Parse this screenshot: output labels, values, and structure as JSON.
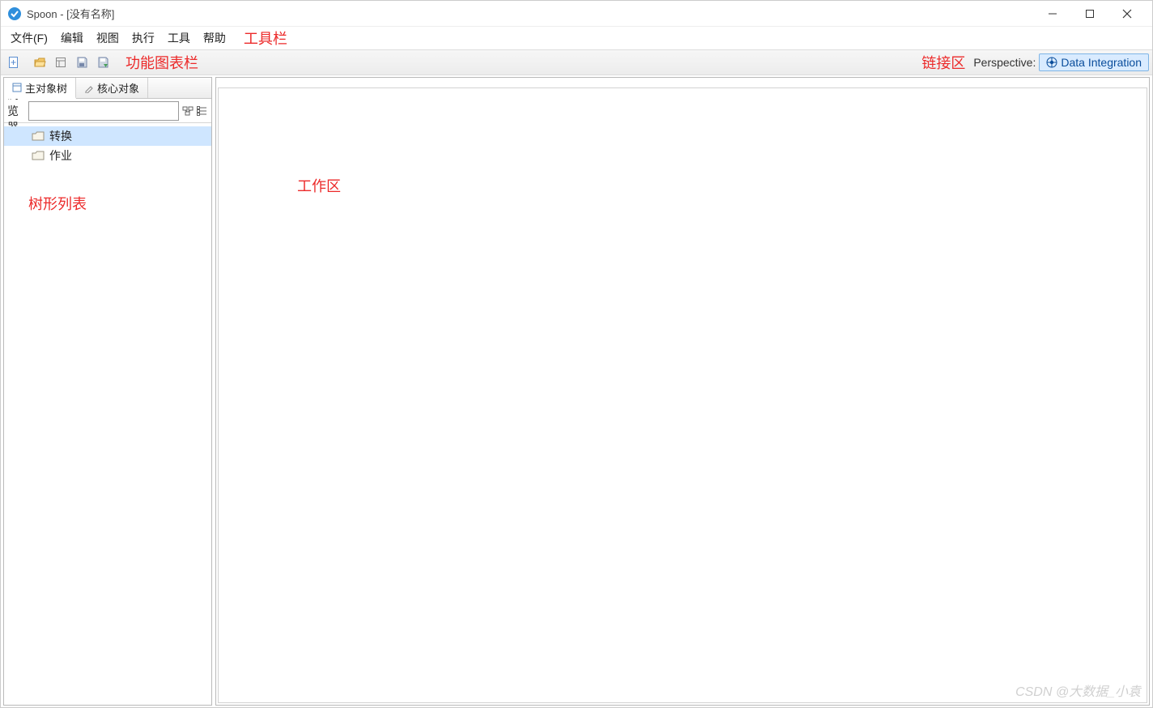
{
  "title": "Spoon - [没有名称]",
  "menu": [
    "文件(F)",
    "编辑",
    "视图",
    "执行",
    "工具",
    "帮助"
  ],
  "annotations": {
    "menubar": "工具栏",
    "toolbar": "功能图表栏",
    "linkarea": "链接区",
    "workspace": "工作区",
    "treelist": "树形列表"
  },
  "perspective": {
    "label": "Perspective:",
    "value": "Data Integration"
  },
  "sidebar": {
    "tabs": [
      {
        "label": "主对象树"
      },
      {
        "label": "核心对象"
      }
    ],
    "filter_label": "浏览器",
    "filter_value": "",
    "tree_items": [
      "转换",
      "作业"
    ]
  },
  "watermark": "CSDN @大数据_小袁"
}
